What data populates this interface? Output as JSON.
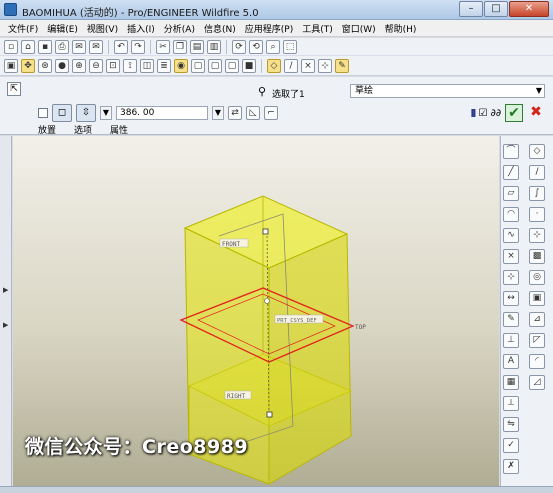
{
  "window": {
    "title": "BAOMIHUA (活动的) - Pro/ENGINEER Wildfire 5.0",
    "minimize": "–",
    "maximize": "□",
    "close": "✕"
  },
  "menu": [
    "文件(F)",
    "编辑(E)",
    "视图(V)",
    "插入(I)",
    "分析(A)",
    "信息(N)",
    "应用程序(P)",
    "工具(T)",
    "窗口(W)",
    "帮助(H)"
  ],
  "toolbar1_icons": [
    "new-icon",
    "open-icon",
    "save-icon",
    "print-icon",
    "email-icon",
    "email-link-icon",
    "undo-icon",
    "redo-icon",
    "cut-icon",
    "copy-icon",
    "paste-icon",
    "paste-special-icon",
    "regenerate-icon",
    "regenerate-manager-icon",
    "find-icon",
    "select-box-icon"
  ],
  "toolbar2_icons": [
    "repaint-icon",
    "spin-center-icon",
    "orient-mode-icon",
    "shading-icon",
    "zoom-in-icon",
    "zoom-out-icon",
    "refit-icon",
    "reorient-icon",
    "saved-views-icon",
    "layers-icon",
    "view-manager-icon",
    "wireframe-icon",
    "hidden-line-icon",
    "no-hidden-icon",
    "shaded-icon",
    "datum-planes-icon",
    "datum-axes-icon",
    "datum-points-icon",
    "csys-icon",
    "annotations-icon"
  ],
  "dashboard": {
    "reference_label": "选取了1",
    "sketch_select": "草绘",
    "depth_value": "386. 00",
    "tabs": [
      "放置",
      "选项",
      "属性"
    ],
    "pause_label": "II",
    "preview_label": "☑ ∂∂",
    "ok_label": "✔",
    "cancel_label": "✖"
  },
  "viewport": {
    "plane_labels": {
      "front": "FRONT",
      "right": "RIGHT",
      "top": "TOP",
      "csys": "PRT_CSYS_DEF"
    },
    "watermark": "微信公众号：Creo8989"
  },
  "right_toolbar": {
    "column1": [
      "sketch-options-icon",
      "line-icon",
      "rectangle-icon",
      "arc-icon",
      "spline-icon",
      "point-icon",
      "centerline-icon",
      "dimension-icon",
      "modify-icon",
      "constraints-icon",
      "text-icon",
      "palette-icon",
      "trim-icon",
      "mirror-icon",
      "done-icon",
      "quit-icon"
    ],
    "column2": [
      "datum-plane-icon",
      "datum-axis-icon",
      "datum-curve-icon",
      "datum-point-icon",
      "csys-tool-icon",
      "analysis-icon",
      "hole-icon",
      "shell-icon",
      "rib-icon",
      "draft-icon",
      "round-icon",
      "chamfer-icon"
    ]
  },
  "colors": {
    "solid": "#e6e600",
    "solid_edge": "#b8b800",
    "sketch": "#e2231a",
    "datum": "#8a8a70"
  }
}
